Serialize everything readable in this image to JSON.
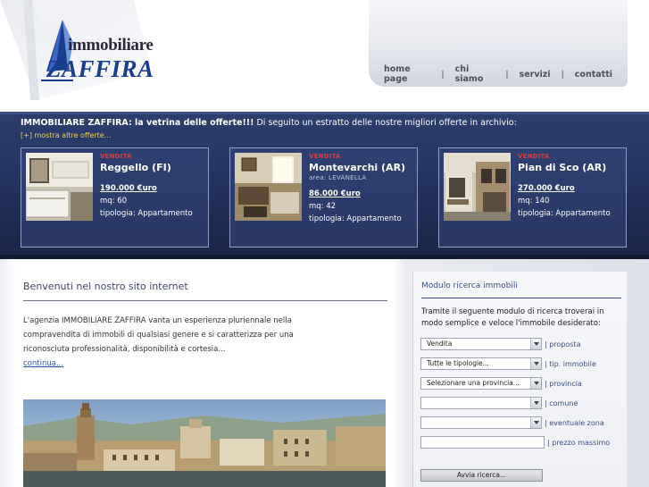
{
  "brand": {
    "logo_word1": "immobiliare",
    "logo_word2": "ZAFFIRA",
    "accent": "#1a3e8e"
  },
  "nav": {
    "items": [
      {
        "label": "home page"
      },
      {
        "label": "chi siamo"
      },
      {
        "label": "servizi"
      },
      {
        "label": "contatti"
      }
    ],
    "separator": "|"
  },
  "band": {
    "intro_bold": "IMMOBILIARE ZAFFIRA: la vetrina delle offerte!!!",
    "intro_rest": " Di seguito un estratto delle nostre migliori offerte in archivio:",
    "more_link": "[+] mostra altre offerte...",
    "offers": [
      {
        "kind": "VENDITA",
        "city": "Reggello (FI)",
        "area": "",
        "price": "190.000 €uro",
        "size": "mq: 60",
        "type": "tipologia: Appartamento",
        "photo_icon": "kitchen-photo"
      },
      {
        "kind": "VENDITA",
        "city": "Montevarchi (AR)",
        "area": "area: LEVANELLA",
        "price": "86.000 €uro",
        "size": "mq: 42",
        "type": "tipologia: Appartamento",
        "photo_icon": "livingroom-photo"
      },
      {
        "kind": "VENDITA",
        "city": "Pian di Sco (AR)",
        "area": "",
        "price": "270.000 €uro",
        "size": "mq: 140",
        "type": "tipologia: Appartamento",
        "photo_icon": "house-exterior-photo"
      }
    ]
  },
  "welcome": {
    "title": "Benvenuti nel nostro sito internet",
    "text": "L'agenzia IMMOBILIARE ZAFFIRA vanta un esperienza pluriennale nella compravendita di immobili di qualsiasi genere e si caratterizza per una riconosciuta professionalità, disponibilità e cortesia...",
    "more_link": "continua...",
    "photo_icon": "florence-cityscape-photo"
  },
  "search": {
    "title": "Modulo ricerca immobili",
    "intro": "Tramite il seguente modulo di ricerca troverai in modo semplice e veloce l'immobile desiderato:",
    "fields": [
      {
        "value": "Vendita",
        "label": "| proposta"
      },
      {
        "value": "Tutte le tipologie...",
        "label": "| tip. immobile"
      },
      {
        "value": "Selezionare una provincia...",
        "label": "| provincia"
      },
      {
        "value": "",
        "label": "| comune"
      },
      {
        "value": "",
        "label": "| eventuale zona"
      }
    ],
    "price_label": "| prezzo massimo",
    "price_value": "",
    "button_label": "Avvia ricerca..."
  },
  "colors": {
    "band": "#243765",
    "offer_kind": "#e63a30",
    "more_link": "#f1d34b",
    "link": "#2a55a6"
  }
}
